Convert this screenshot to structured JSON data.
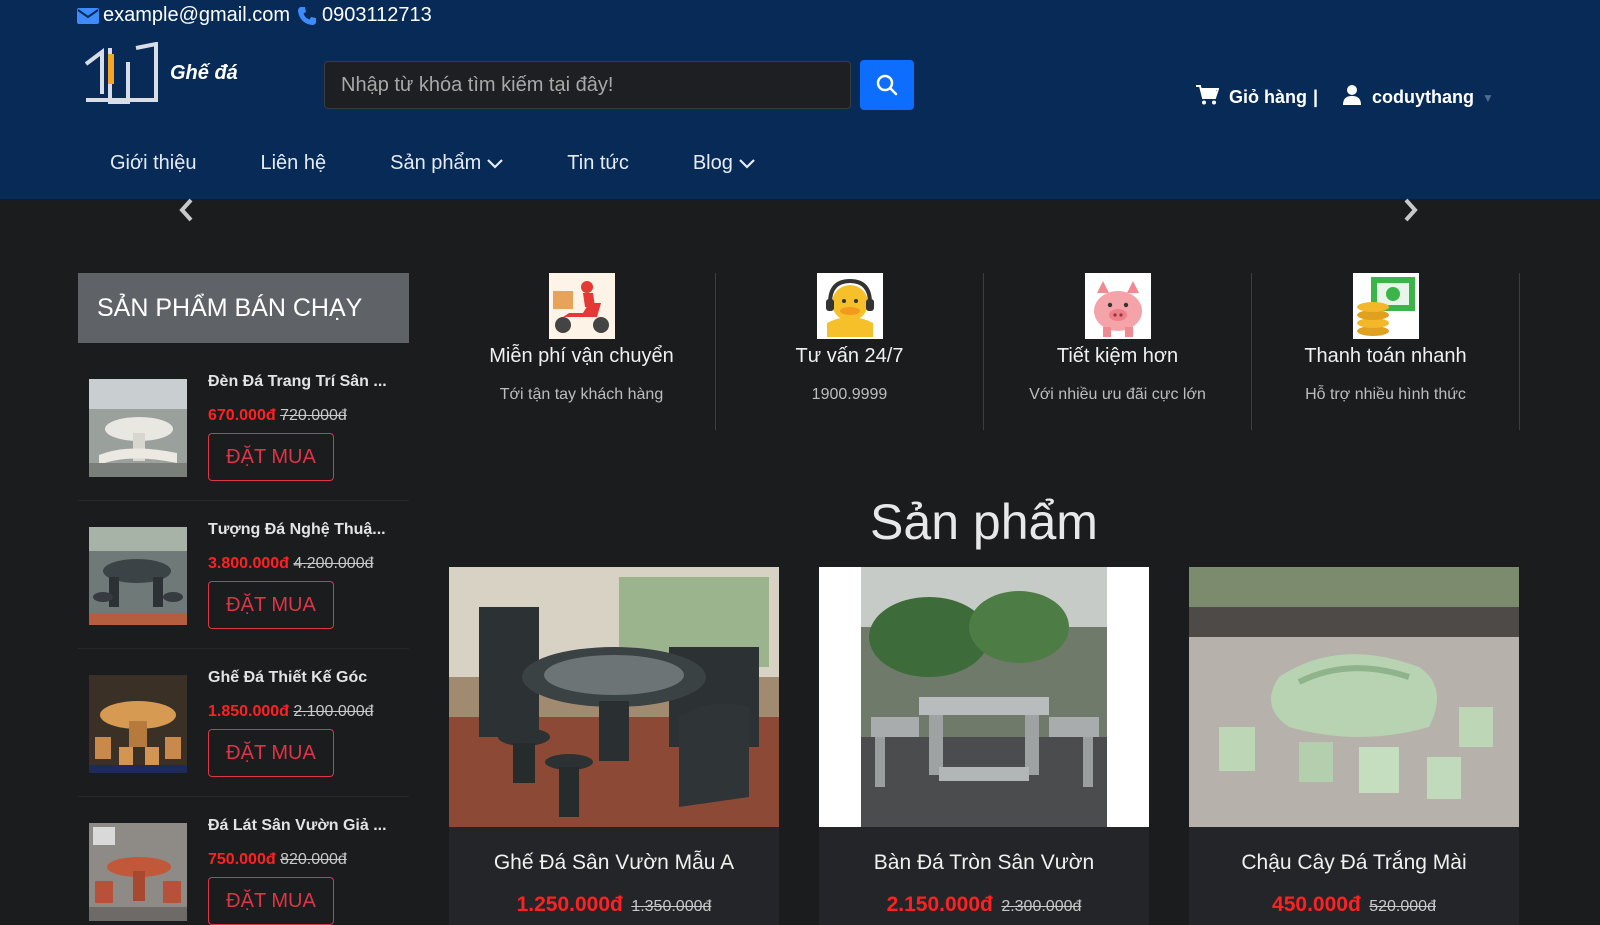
{
  "topbar": {
    "email": "example@gmail.com",
    "phone": "0903112713"
  },
  "logo": {
    "brand": "Ghế đá"
  },
  "search": {
    "placeholder": "Nhập từ khóa tìm kiếm tại đây!"
  },
  "account": {
    "cart_label": "Giỏ hàng",
    "separator": "|",
    "username": "coduythang"
  },
  "nav": [
    "Giới thiệu",
    "Liên hệ",
    "Sản phẩm",
    "Tin tức",
    "Blog"
  ],
  "sidebar": {
    "title": "SẢN PHẨM BÁN CHẠY",
    "items": [
      {
        "name": "Đèn Đá Trang Trí Sân ...",
        "price": "670.000đ",
        "old_price": "720.000đ",
        "button": "ĐẶT MUA"
      },
      {
        "name": "Tượng Đá Nghệ Thuậ...",
        "price": "3.800.000đ",
        "old_price": "4.200.000đ",
        "button": "ĐẶT MUA"
      },
      {
        "name": "Ghế Đá Thiết Kế Góc",
        "price": "1.850.000đ",
        "old_price": "2.100.000đ",
        "button": "ĐẶT MUA"
      },
      {
        "name": "Đá Lát Sân Vườn Giả ...",
        "price": "750.000đ",
        "old_price": "820.000đ",
        "button": "ĐẶT MUA"
      }
    ]
  },
  "features": [
    {
      "title": "Miễn phí vận chuyển",
      "subtitle": "Tới tận tay khách hàng",
      "icon": "delivery-scooter-icon"
    },
    {
      "title": "Tư vấn 24/7",
      "subtitle": "1900.9999",
      "icon": "support-headset-icon"
    },
    {
      "title": "Tiết kiệm hơn",
      "subtitle": "Với nhiều ưu đãi cực lớn",
      "icon": "piggy-bank-icon"
    },
    {
      "title": "Thanh toán nhanh",
      "subtitle": "Hỗ trợ nhiều hình thức",
      "icon": "coins-payment-icon"
    }
  ],
  "products_section": {
    "title": "Sản phẩm",
    "items": [
      {
        "name": "Ghế Đá Sân Vườn Mẫu A",
        "price": "1.250.000đ",
        "old_price": "1.350.000đ"
      },
      {
        "name": "Bàn Đá Tròn Sân Vườn",
        "price": "2.150.000đ",
        "old_price": "2.300.000đ"
      },
      {
        "name": "Chậu Cây Đá Trắng Mài",
        "price": "450.000đ",
        "old_price": "520.000đ"
      }
    ]
  },
  "colors": {
    "header_bg": "#072a56",
    "page_bg": "#1b1c1e",
    "accent_blue": "#0d6efd",
    "price_red": "#ff2121",
    "button_red": "#dc3545"
  }
}
